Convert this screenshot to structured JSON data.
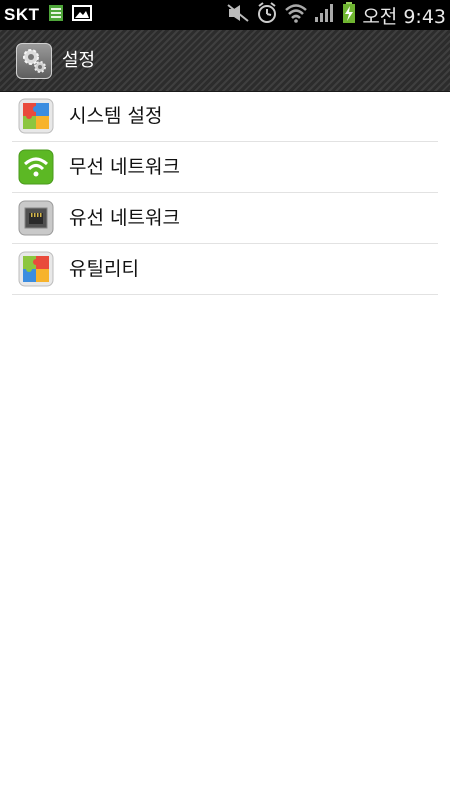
{
  "status_bar": {
    "carrier": "SKT",
    "time": "오전 9:43",
    "icons": [
      "sim-card-icon",
      "image-icon",
      "mute-icon",
      "alarm-icon",
      "wifi-icon",
      "signal-icon",
      "battery-charging-icon"
    ]
  },
  "action_bar": {
    "title": "설정",
    "icon": "settings-gear-icon"
  },
  "list": {
    "items": [
      {
        "label": "시스템 설정",
        "icon": "puzzle-icon"
      },
      {
        "label": "무선 네트워크",
        "icon": "wifi-icon"
      },
      {
        "label": "유선 네트워크",
        "icon": "ethernet-port-icon"
      },
      {
        "label": "유틸리티",
        "icon": "puzzle-icon"
      }
    ]
  },
  "colors": {
    "action_bar_bg": "#353535",
    "list_divider": "#e2e2e2",
    "wifi_green": "#5cb824"
  }
}
